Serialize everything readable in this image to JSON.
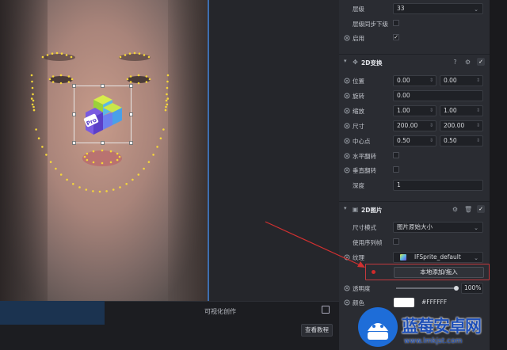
{
  "viewport": {
    "bottom_title": "可视化创作",
    "tutorial_button": "查看教程"
  },
  "inspector": {
    "layer_row": {
      "label": "层级",
      "value": "33"
    },
    "layer_sync": {
      "label": "层级同步下级"
    },
    "enable": {
      "label": "启用",
      "checked": true
    },
    "transform2d": {
      "title": "2D变换",
      "position": {
        "label": "位置",
        "x": "0.00",
        "y": "0.00"
      },
      "rotation": {
        "label": "旋转",
        "value": "0.00"
      },
      "scale": {
        "label": "缩放",
        "x": "1.00",
        "y": "1.00"
      },
      "size": {
        "label": "尺寸",
        "w": "200.00",
        "h": "200.00"
      },
      "pivot": {
        "label": "中心点",
        "x": "0.50",
        "y": "0.50"
      },
      "flip_h": {
        "label": "水平翻转"
      },
      "flip_v": {
        "label": "垂直翻转"
      },
      "depth": {
        "label": "深度",
        "value": "1"
      }
    },
    "image2d": {
      "title": "2D图片",
      "size_mode": {
        "label": "尺寸模式",
        "value": "图片原始大小"
      },
      "use_sequence": {
        "label": "使用序列帧"
      },
      "texture": {
        "label": "纹理",
        "value": "IFSprite_default"
      },
      "add_local_button": "本地添加/拖入",
      "opacity": {
        "label": "透明度",
        "value": "100%",
        "level": 1.0
      },
      "color": {
        "label": "颜色",
        "value": "#FFFFFF"
      }
    }
  },
  "watermark": {
    "title": "蓝莓安卓网",
    "url": "www.lmkjst.com"
  },
  "colors": {
    "panel_bg": "#2a2c32",
    "highlight": "#c4393e",
    "accent": "#3e6fb0"
  }
}
